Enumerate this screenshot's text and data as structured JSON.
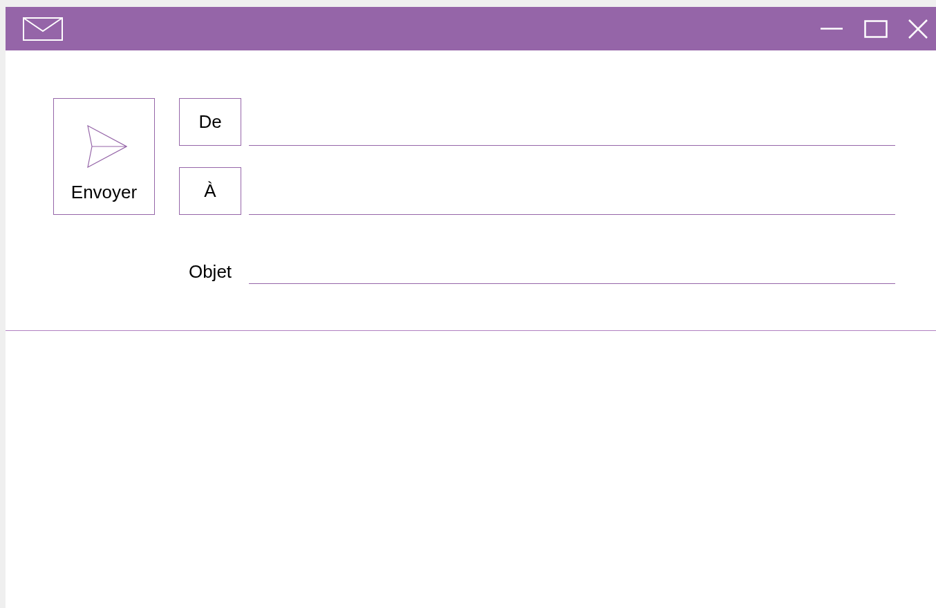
{
  "send_button": {
    "label": "Envoyer"
  },
  "fields": [
    {
      "label": "De",
      "kind": "boxed"
    },
    {
      "label": "À",
      "kind": "boxed"
    },
    {
      "label": "Objet",
      "kind": "plain"
    }
  ]
}
